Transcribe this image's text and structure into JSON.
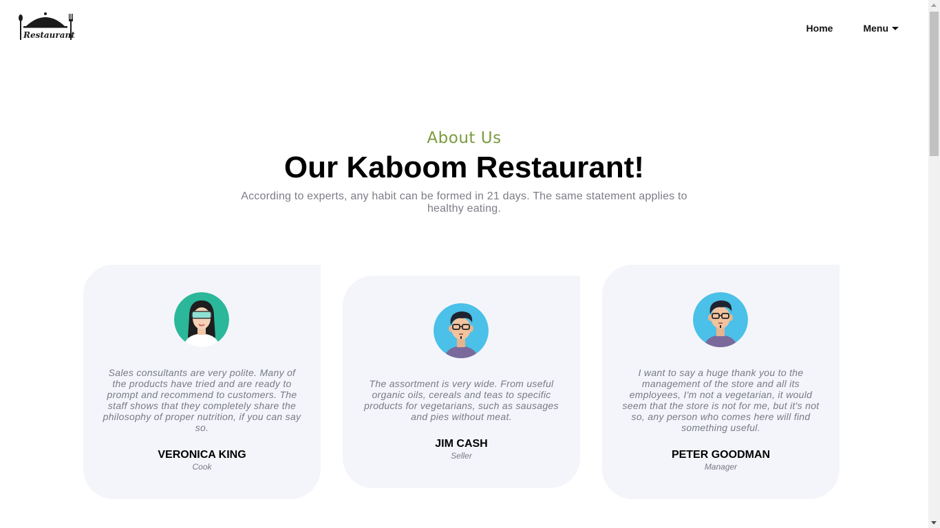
{
  "header": {
    "logo_text": "Restaurant",
    "nav": {
      "home_label": "Home",
      "menu_label": "Menu"
    }
  },
  "hero": {
    "eyebrow": "About Us",
    "title": "Our Kaboom Restaurant!",
    "subtitle": "According to experts, any habit can be formed in 21 days. The same statement applies to healthy eating."
  },
  "testimonials": [
    {
      "quote": "Sales consultants are very polite. Many of the products have tried and are ready to prompt and recommend to customers. The staff shows that they completely share the philosophy of proper nutrition, if you can say so.",
      "name": "VERONICA KING",
      "role": "Cook",
      "avatar_icon": "woman-with-vr-goggles-avatar",
      "avatar_bg": "#2bb79a"
    },
    {
      "quote": "The assortment is very wide. From useful organic oils, cereals and teas to specific products for vegetarians, such as sausages and pies without meat.",
      "name": "JIM CASH",
      "role": "Seller",
      "avatar_icon": "man-with-glasses-avatar",
      "avatar_bg": "#4bc0e8"
    },
    {
      "quote": "I want to say a huge thank you to the management of the store and all its employees, I'm not a vegetarian, it would seem that the store is not for me, but it's not so, any person who comes here will find something useful.",
      "name": "PETER GOODMAN",
      "role": "Manager",
      "avatar_icon": "man-with-glasses-avatar",
      "avatar_bg": "#4bc0e8"
    }
  ],
  "colors": {
    "accent_green": "#7a9a3e",
    "card_bg": "#f4f5fa",
    "muted_text": "#777a84"
  }
}
